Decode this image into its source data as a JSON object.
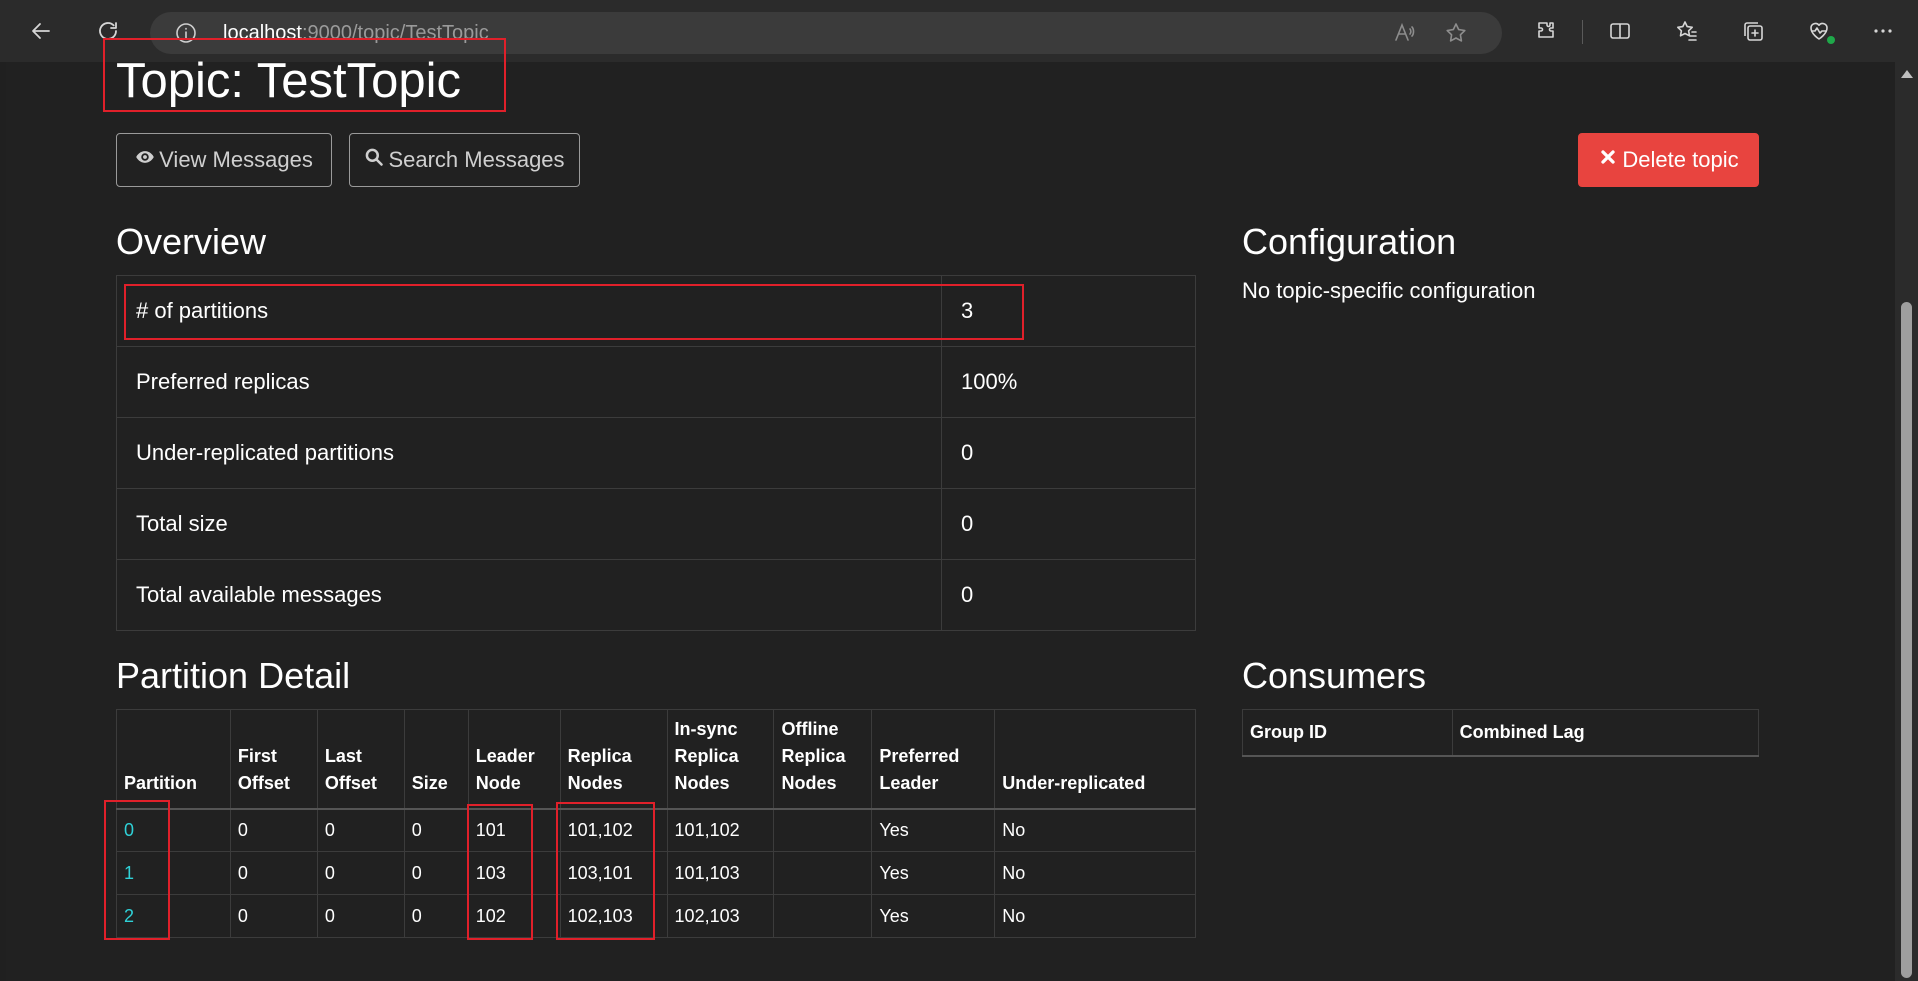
{
  "browser": {
    "url_host": "localhost",
    "url_path": ":9000/topic/TestTopic"
  },
  "header": {
    "title": "Topic: TestTopic"
  },
  "actions": {
    "view_messages": "View Messages",
    "search_messages": "Search Messages",
    "delete_topic": "Delete topic"
  },
  "overview": {
    "heading": "Overview",
    "rows": [
      {
        "label": "# of partitions",
        "value": "3"
      },
      {
        "label": "Preferred replicas",
        "value": "100%"
      },
      {
        "label": "Under-replicated partitions",
        "value": "0"
      },
      {
        "label": "Total size",
        "value": "0"
      },
      {
        "label": "Total available messages",
        "value": "0"
      }
    ]
  },
  "configuration": {
    "heading": "Configuration",
    "text": "No topic-specific configuration"
  },
  "partition_detail": {
    "heading": "Partition Detail",
    "columns": [
      [
        "Partition"
      ],
      [
        "First",
        "Offset"
      ],
      [
        "Last",
        "Offset"
      ],
      [
        "Size"
      ],
      [
        "Leader",
        "Node"
      ],
      [
        "Replica",
        "Nodes"
      ],
      [
        "In-sync",
        "Replica",
        "Nodes"
      ],
      [
        "Offline",
        "Replica",
        "Nodes"
      ],
      [
        "Preferred",
        "Leader"
      ],
      [
        "Under-replicated"
      ]
    ],
    "rows": [
      [
        "0",
        "0",
        "0",
        "0",
        "101",
        "101,102",
        "101,102",
        "",
        "Yes",
        "No"
      ],
      [
        "1",
        "0",
        "0",
        "0",
        "103",
        "103,101",
        "101,103",
        "",
        "Yes",
        "No"
      ],
      [
        "2",
        "0",
        "0",
        "0",
        "102",
        "102,103",
        "102,103",
        "",
        "Yes",
        "No"
      ]
    ]
  },
  "consumers": {
    "heading": "Consumers",
    "columns": [
      "Group ID",
      "Combined Lag"
    ]
  },
  "colors": {
    "link": "#2fd1d7",
    "danger": "#e8443f",
    "highlight": "#e0202a",
    "background": "#202020"
  },
  "icons": [
    "back-icon",
    "refresh-icon",
    "info-icon",
    "read-aloud-icon",
    "favorite-star-icon",
    "extensions-icon",
    "split-screen-icon",
    "favorites-icon",
    "collections-icon",
    "browser-essentials-icon",
    "more-icon",
    "eye-icon",
    "search-icon",
    "close-icon"
  ]
}
